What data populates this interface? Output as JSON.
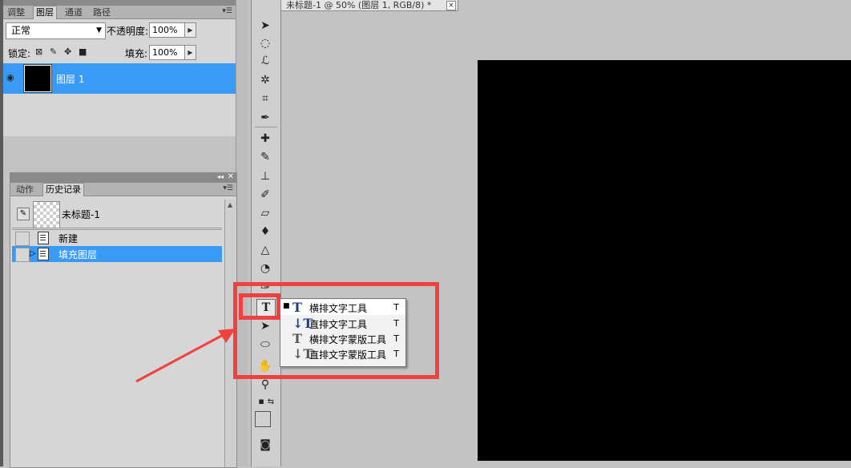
{
  "layers_panel": {
    "tabs": [
      "调整",
      "图层",
      "通道",
      "路径"
    ],
    "active_tab": "图层",
    "blend_mode": "正常",
    "opacity_label": "不透明度:",
    "opacity_value": "100%",
    "lock_label": "锁定:",
    "fill_label": "填充:",
    "fill_value": "100%",
    "layers": [
      {
        "name": "图层 1",
        "selected": true
      }
    ]
  },
  "history_panel": {
    "tabs": [
      "动作",
      "历史记录"
    ],
    "active_tab": "历史记录",
    "snapshot_name": "未标题-1",
    "steps": [
      {
        "label": "新建",
        "selected": false
      },
      {
        "label": "填充图层",
        "selected": true
      }
    ]
  },
  "document": {
    "tab_title": "未标题-1 @ 50% (图层 1, RGB/8) *",
    "close_glyph": "×"
  },
  "type_tool_flyout": {
    "items": [
      {
        "label": "横排文字工具",
        "shortcut": "T",
        "icon": "horizontal-type-icon",
        "active": true
      },
      {
        "label": "直排文字工具",
        "shortcut": "T",
        "icon": "vertical-type-icon",
        "active": false
      },
      {
        "label": "横排文字蒙版工具",
        "shortcut": "T",
        "icon": "horizontal-type-mask-icon",
        "active": false
      },
      {
        "label": "直排文字蒙版工具",
        "shortcut": "T",
        "icon": "vertical-type-mask-icon",
        "active": false
      }
    ]
  },
  "colors": {
    "selection": "#3a9bf6",
    "annotation": "#f04040",
    "canvas": "#000000"
  }
}
